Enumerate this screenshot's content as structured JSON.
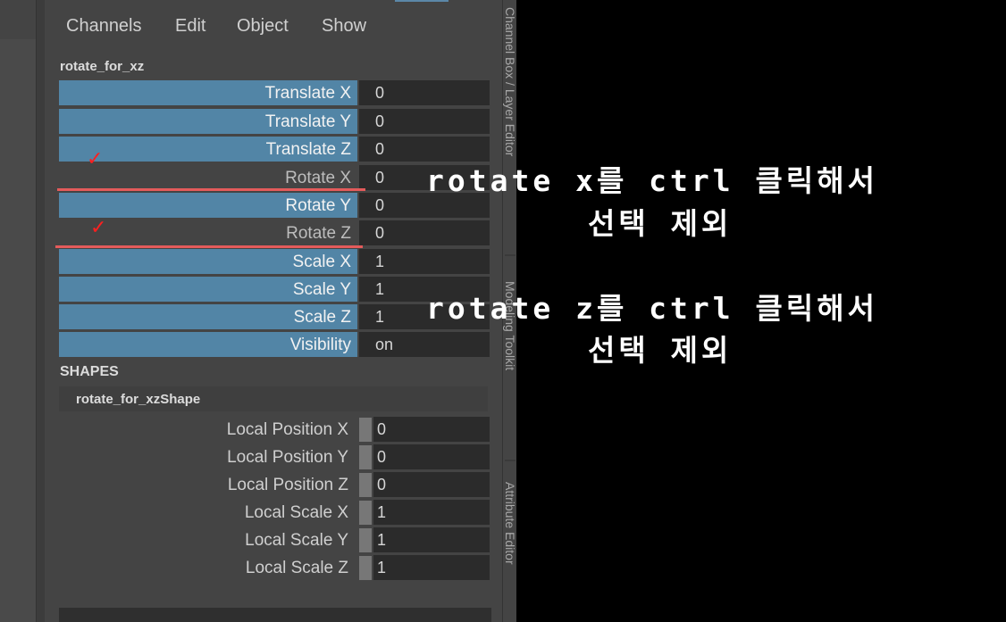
{
  "menu": [
    "Channels",
    "Edit",
    "Object",
    "Show"
  ],
  "object_name": "rotate_for_xz",
  "channels": [
    {
      "label": "Translate X",
      "value": "0",
      "selected": true
    },
    {
      "label": "Translate Y",
      "value": "0",
      "selected": true
    },
    {
      "label": "Translate Z",
      "value": "0",
      "selected": true
    },
    {
      "label": "Rotate X",
      "value": "0",
      "selected": false
    },
    {
      "label": "Rotate Y",
      "value": "0",
      "selected": true
    },
    {
      "label": "Rotate Z",
      "value": "0",
      "selected": false
    },
    {
      "label": "Scale X",
      "value": "1",
      "selected": true
    },
    {
      "label": "Scale Y",
      "value": "1",
      "selected": true
    },
    {
      "label": "Scale Z",
      "value": "1",
      "selected": true
    },
    {
      "label": "Visibility",
      "value": "on",
      "selected": true
    }
  ],
  "shapes_header": "SHAPES",
  "shape_name": "rotate_for_xzShape",
  "shape_channels": [
    {
      "label": "Local Position X",
      "value": "0"
    },
    {
      "label": "Local Position Y",
      "value": "0"
    },
    {
      "label": "Local Position Z",
      "value": "0"
    },
    {
      "label": "Local Scale X",
      "value": "1"
    },
    {
      "label": "Local Scale Y",
      "value": "1"
    },
    {
      "label": "Local Scale Z",
      "value": "1"
    }
  ],
  "side_tabs": [
    "Channel Box / Layer Editor",
    "Modeling Toolkit",
    "Attribute Editor"
  ],
  "annotations": {
    "check_mark": "✓",
    "note1_line1": "rotate x를 ctrl 클릭해서",
    "note1_line2": "선택 제외",
    "note2_line1": "rotate z를 ctrl 클릭해서",
    "note2_line2": "선택 제외"
  },
  "colors": {
    "selected_channel": "#5285a6",
    "annotation_red": "#e45b5b"
  }
}
